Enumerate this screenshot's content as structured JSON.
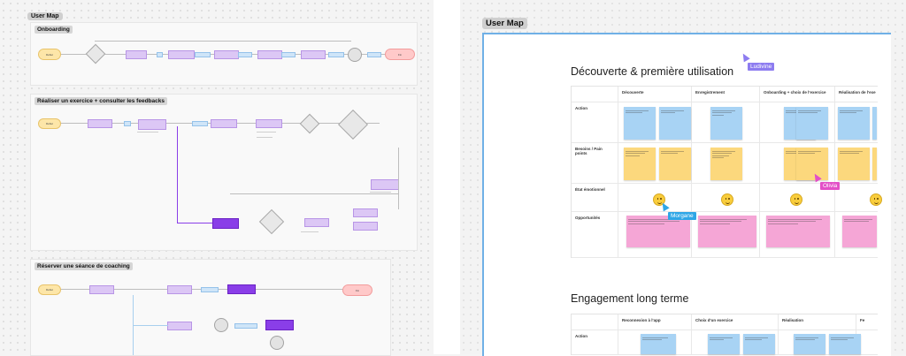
{
  "canvas": {
    "left_board_label": "User Map",
    "right_board_label": "User Map"
  },
  "flows": [
    {
      "title": "Onboarding"
    },
    {
      "title": "Réaliser un exercice + consulter les feedbacks"
    },
    {
      "title": "Réserver une séance de coaching"
    }
  ],
  "flow_nodes": {
    "start": "Début",
    "end": "Fin"
  },
  "map": {
    "section1_title": "Découverte & première utilisation",
    "section1_columns": [
      "Découverte",
      "Enregistrement",
      "Onboarding + choix de l'exercice",
      "Réalisation de l'exe"
    ],
    "section1_rows": [
      "Action",
      "Besoins / Pain points",
      "État émotionnel",
      "Opportunités"
    ],
    "section2_title": "Engagement long terme",
    "section2_columns": [
      "Reconnexion à l'app",
      "Choix d'un exercice",
      "Réalisation",
      "Fe"
    ],
    "section2_rows": [
      "Action"
    ]
  },
  "cursors": [
    {
      "name": "Ludivine",
      "color": "#8d7cf0"
    },
    {
      "name": "Olivia",
      "color": "#e34fc7"
    },
    {
      "name": "Morgane",
      "color": "#2fa6e6"
    }
  ],
  "colors": {
    "frame_border": "#6fb0e6",
    "sticky_blue": "#a8d3f4",
    "sticky_yellow": "#fcd87d",
    "sticky_pink": "#f5a6d6"
  }
}
